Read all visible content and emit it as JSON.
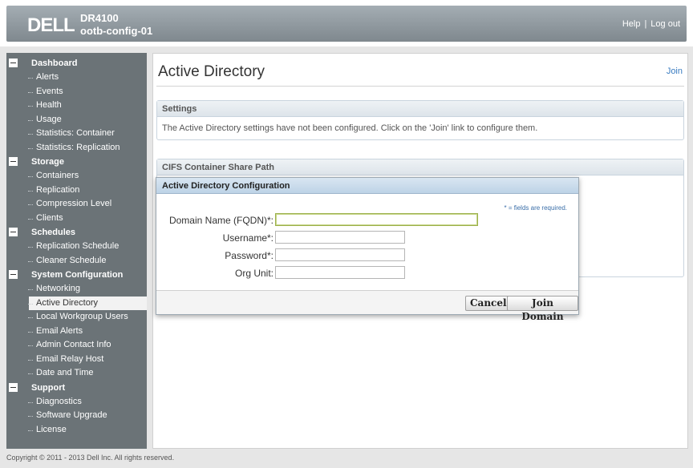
{
  "header": {
    "logo": "DELL",
    "model": "DR4100",
    "hostname": "ootb-config-01",
    "help_label": "Help",
    "separator": "|",
    "logout_label": "Log out"
  },
  "sidebar": {
    "groups": [
      {
        "label": "Dashboard",
        "items": [
          "Alerts",
          "Events",
          "Health",
          "Usage",
          "Statistics: Container",
          "Statistics: Replication"
        ]
      },
      {
        "label": "Storage",
        "items": [
          "Containers",
          "Replication",
          "Compression Level",
          "Clients"
        ]
      },
      {
        "label": "Schedules",
        "items": [
          "Replication Schedule",
          "Cleaner Schedule"
        ]
      },
      {
        "label": "System Configuration",
        "items": [
          "Networking",
          "Active Directory",
          "Local Workgroup Users",
          "Email Alerts",
          "Admin Contact Info",
          "Email Relay Host",
          "Date and Time"
        ]
      },
      {
        "label": "Support",
        "items": [
          "Diagnostics",
          "Software Upgrade",
          "License"
        ]
      }
    ],
    "active_item": "Active Directory"
  },
  "main": {
    "title": "Active Directory",
    "join_link": "Join",
    "settings_panel": {
      "heading": "Settings",
      "message": "The Active Directory settings have not been configured. Click on the 'Join' link to configure them."
    },
    "cifs_panel": {
      "heading": "CIFS Container Share Path"
    }
  },
  "modal": {
    "title": "Active Directory Configuration",
    "required_note": "* = fields are required.",
    "fields": {
      "domain_label": "Domain Name (FQDN)*:",
      "domain_value": "",
      "username_label": "Username*:",
      "username_value": "",
      "password_label": "Password*:",
      "password_value": "",
      "orgunit_label": "Org Unit:",
      "orgunit_value": ""
    },
    "cancel_label": "Cancel",
    "join_label": "Join Domain"
  },
  "footer": {
    "copyright": "Copyright © 2011 - 2013 Dell Inc. All rights reserved."
  },
  "colors": {
    "header_bar": "#8d969c",
    "sidebar_bg": "#6b7377",
    "link": "#3a7cc1"
  }
}
